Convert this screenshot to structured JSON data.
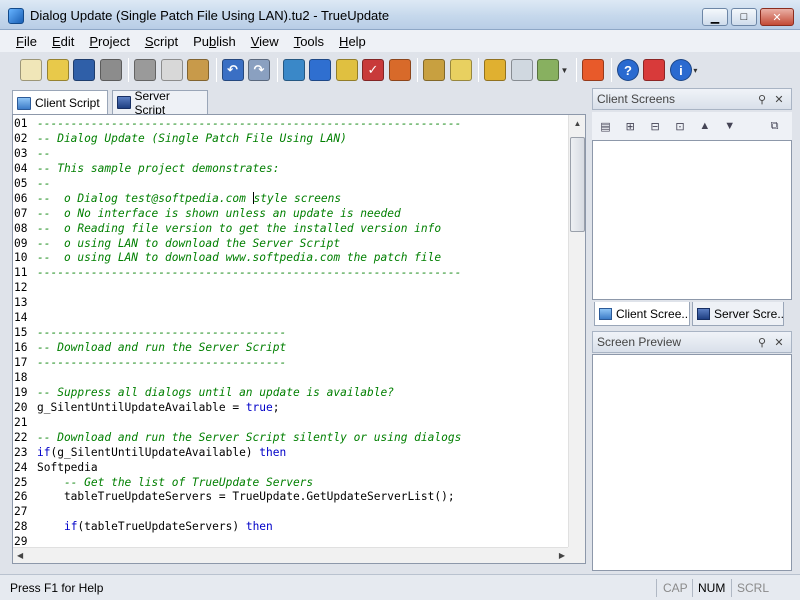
{
  "window": {
    "title": "Dialog Update (Single Patch File Using LAN).tu2 - TrueUpdate",
    "min": "▁",
    "max": "□",
    "close": "✕"
  },
  "menu": [
    {
      "pre": "",
      "u": "F",
      "post": "ile"
    },
    {
      "pre": "",
      "u": "E",
      "post": "dit"
    },
    {
      "pre": "",
      "u": "P",
      "post": "roject"
    },
    {
      "pre": "",
      "u": "S",
      "post": "cript"
    },
    {
      "pre": "Pu",
      "u": "b",
      "post": "lish"
    },
    {
      "pre": "",
      "u": "V",
      "post": "iew"
    },
    {
      "pre": "",
      "u": "T",
      "post": "ools"
    },
    {
      "pre": "",
      "u": "H",
      "post": "elp"
    }
  ],
  "toolbar": {
    "colors": {
      "new": "#f0e6b8",
      "open": "#e8c94a",
      "save": "#2f5fa8",
      "print": "#8c8c8c",
      "cut": "#9a9a9a",
      "copy": "#d8d8d8",
      "paste": "#c89a4a",
      "undo": "#3a6fc4",
      "redo": "#8aa0c0",
      "globe": "#3a88c8",
      "blocks": "#2f6fd0",
      "edit": "#e0c040",
      "check": "#c83a3a",
      "firewall": "#d86a2a",
      "disc": "#c8a040",
      "notes": "#e8d060",
      "wizard": "#e0b030",
      "doc": "#d0d8e0",
      "list": "#88b060",
      "arrow": "#e85a2a",
      "help": "#2a6ad0",
      "pdf": "#d83a3a",
      "info": "#2a6ad0"
    },
    "glyphs": {
      "help": "?",
      "info": "i",
      "check": "✓",
      "undo": "↶",
      "redo": "↷"
    }
  },
  "editor": {
    "tabs": [
      "Client Script",
      "Server Script"
    ],
    "lines": [
      {
        "n": "01",
        "parts": [
          {
            "c": "cm",
            "t": "---------------------------------------------------------------"
          }
        ]
      },
      {
        "n": "02",
        "parts": [
          {
            "c": "cm",
            "t": "-- Dialog Update (Single Patch File Using LAN)"
          }
        ]
      },
      {
        "n": "03",
        "parts": [
          {
            "c": "cm",
            "t": "--"
          }
        ]
      },
      {
        "n": "04",
        "parts": [
          {
            "c": "cm",
            "t": "-- This sample project demonstrates:"
          }
        ]
      },
      {
        "n": "05",
        "parts": [
          {
            "c": "cm",
            "t": "--"
          }
        ]
      },
      {
        "n": "06",
        "parts": [
          {
            "c": "cm",
            "t": "--  o Dialog test@softpedia.com "
          },
          {
            "c": "caret",
            "t": ""
          },
          {
            "c": "cm",
            "t": "style screens"
          }
        ]
      },
      {
        "n": "07",
        "parts": [
          {
            "c": "cm",
            "t": "--  o No interface is shown unless an update is needed"
          }
        ]
      },
      {
        "n": "08",
        "parts": [
          {
            "c": "cm",
            "t": "--  o Reading file version to get the installed version info"
          }
        ]
      },
      {
        "n": "09",
        "parts": [
          {
            "c": "cm",
            "t": "--  o using LAN to download the Server Script"
          }
        ]
      },
      {
        "n": "10",
        "parts": [
          {
            "c": "cm",
            "t": "--  o using LAN to download www.softpedia.com the patch file"
          }
        ]
      },
      {
        "n": "11",
        "parts": [
          {
            "c": "cm",
            "t": "---------------------------------------------------------------"
          }
        ]
      },
      {
        "n": "12",
        "parts": []
      },
      {
        "n": "13",
        "parts": []
      },
      {
        "n": "14",
        "parts": []
      },
      {
        "n": "15",
        "parts": [
          {
            "c": "cm",
            "t": "-------------------------------------"
          }
        ]
      },
      {
        "n": "16",
        "parts": [
          {
            "c": "cm",
            "t": "-- Download and run the Server Script"
          }
        ]
      },
      {
        "n": "17",
        "parts": [
          {
            "c": "cm",
            "t": "-------------------------------------"
          }
        ]
      },
      {
        "n": "18",
        "parts": []
      },
      {
        "n": "19",
        "parts": [
          {
            "c": "cm",
            "t": "-- Suppress all dialogs until an update is available?"
          }
        ]
      },
      {
        "n": "20",
        "parts": [
          {
            "c": "tx",
            "t": "g_SilentUntilUpdateAvailable = "
          },
          {
            "c": "kw",
            "t": "true"
          },
          {
            "c": "tx",
            "t": ";"
          }
        ]
      },
      {
        "n": "21",
        "parts": []
      },
      {
        "n": "22",
        "parts": [
          {
            "c": "cm",
            "t": "-- Download and run the Server Script silently or using dialogs"
          }
        ]
      },
      {
        "n": "23",
        "parts": [
          {
            "c": "kw",
            "t": "if"
          },
          {
            "c": "tx",
            "t": "(g_SilentUntilUpdateAvailable) "
          },
          {
            "c": "kw",
            "t": "then"
          }
        ]
      },
      {
        "n": "24",
        "parts": [
          {
            "c": "tx",
            "t": "Softpedia"
          }
        ]
      },
      {
        "n": "25",
        "parts": [
          {
            "c": "cm",
            "t": "    -- Get the list of TrueUpdate Servers"
          }
        ]
      },
      {
        "n": "26",
        "parts": [
          {
            "c": "tx",
            "t": "    tableTrueUpdateServers = TrueUpdate.GetUpdateServerList();"
          }
        ]
      },
      {
        "n": "27",
        "parts": []
      },
      {
        "n": "28",
        "parts": [
          {
            "c": "tx",
            "t": "    "
          },
          {
            "c": "kw",
            "t": "if"
          },
          {
            "c": "tx",
            "t": "(tableTrueUpdateServers) "
          },
          {
            "c": "kw",
            "t": "then"
          }
        ]
      },
      {
        "n": "29",
        "parts": []
      }
    ]
  },
  "client_screens": {
    "title": "Client Screens",
    "tools": [
      "▤",
      "⊞",
      "⊟",
      "⊡",
      "▲",
      "▼",
      "⧉"
    ],
    "tabs": [
      "Client Scree...",
      "Server Scre..."
    ]
  },
  "screen_preview": {
    "title": "Screen Preview"
  },
  "statusbar": {
    "text": "Press F1 for Help",
    "cap": "CAP",
    "num": "NUM",
    "scrl": "SCRL"
  },
  "panel_buttons": {
    "pin": "⚲",
    "close": "✕"
  }
}
